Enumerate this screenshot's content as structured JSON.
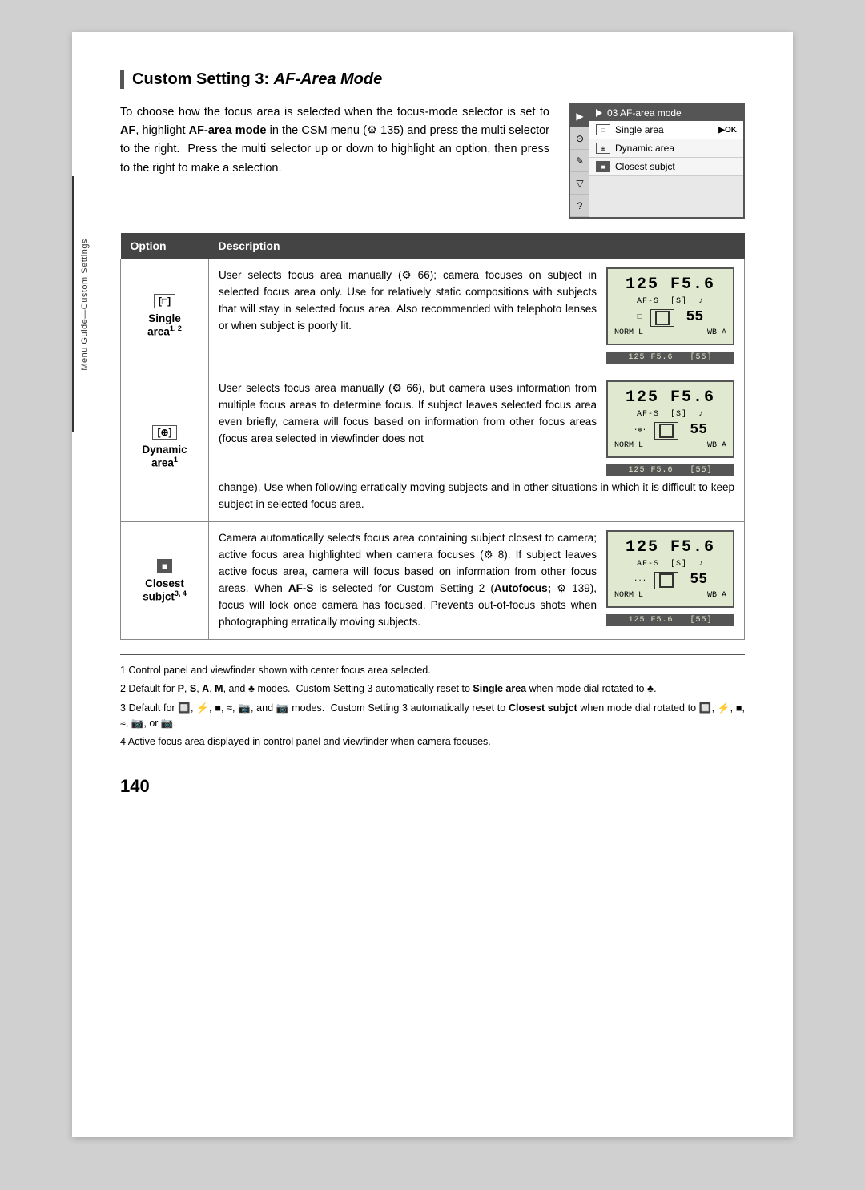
{
  "page": {
    "number": "140",
    "sidebar_label": "Menu Guide—Custom Settings"
  },
  "title": {
    "prefix": "Custom Setting 3: ",
    "italic": "AF-Area Mode"
  },
  "intro": {
    "text": "To choose how the focus area is selected when the focus-mode selector is set to AF, highlight AF-area mode in the CSM menu (⚙ 135) and press the multi selector to the right.  Press the multi selector up or down to highlight an option, then press to the right to make a selection."
  },
  "menu_preview": {
    "title": "03 AF-area mode",
    "items": [
      {
        "icon": "[□]",
        "label": "Single area",
        "arrow": "▶OK",
        "active": true
      },
      {
        "icon": "[⊕]",
        "label": "Dynamic area",
        "active": false
      },
      {
        "icon": "[■]",
        "label": "Closest subjct",
        "active": false
      }
    ]
  },
  "table": {
    "col1_header": "Option",
    "col2_header": "Description",
    "rows": [
      {
        "option_symbol": "[□]",
        "option_name": "Single",
        "option_suffix": "area",
        "option_super": "1, 2",
        "description": "User selects focus area manually (⚙ 66); camera focuses on subject in selected focus area only.  Use for relatively static compositions with subjects that will stay in selected focus area.  Also recommended with telephoto lenses or when subject is poorly lit.",
        "lcd_top": "125  F5.6",
        "lcd_mid": "AF-S [S]",
        "lcd_focus": "single",
        "lcd_norm": "NORM L  WB A",
        "lcd_strip": "125 F5.6    55"
      },
      {
        "option_symbol": "[⊕]",
        "option_name": "Dynamic",
        "option_suffix": "area",
        "option_super": "1",
        "description_upper": "User selects focus area manually (⚙ 66), but camera uses information from multiple focus areas to determine focus.  If subject leaves selected focus area even briefly, camera will focus based on information from other focus areas (focus area selected in viewfinder does not",
        "description_lower": "change).  Use when following erratically moving subjects and in other situations in which it is difficult to keep subject in selected focus area.",
        "lcd_top": "125  F5.6",
        "lcd_mid": "AF-S [S]",
        "lcd_focus": "dynamic",
        "lcd_norm": "NORM L  WB A",
        "lcd_strip": "125 F5.6    55"
      },
      {
        "option_symbol": "[■]",
        "option_name": "Closest",
        "option_suffix": "subjct",
        "option_super": "3, 4",
        "description_p1": "Camera automatically selects focus area containing subject closest to camera; active focus area highlighted when camera focuses (⚙ 8). If subject leaves active focus area, camera will focus based on information from other focus areas.  When AF-S is selected for Custom Setting 2 (Autofocus; ⚙ 139), focus will lock once camera has focused. Prevents out-of-focus shots when photographing erratically moving subjects.",
        "lcd_top": "125  F5.6",
        "lcd_mid": "AF-S [S]",
        "lcd_focus": "closest",
        "lcd_norm": "NORM L  WB A",
        "lcd_strip": "125 F5.6    55"
      }
    ]
  },
  "footnotes": [
    "1 Control panel and viewfinder shown with center focus area selected.",
    "2 Default for P, S, A, M, and ♦ modes.  Custom Setting 3 automatically reset to Single area when mode dial rotated to ♦.",
    "3 Default for 🔲, ⚡, ■, ≈, 📷, and 📷 modes.  Custom Setting 3 automatically reset to Closest subjct when mode dial rotated to 🔲, ⚡, ■, ≈, 📷, or 📷.",
    "4 Active focus area displayed in control panel and viewfinder when camera focuses."
  ]
}
